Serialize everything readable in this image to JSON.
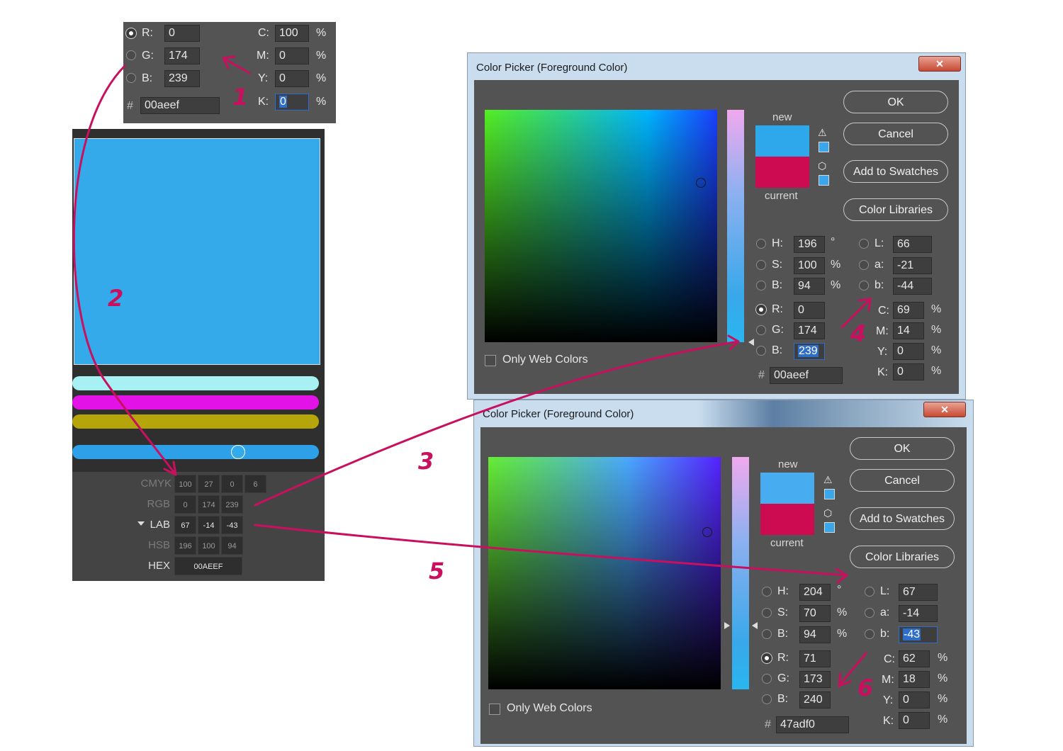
{
  "mini_panel": {
    "r_label": "R:",
    "r_value": "0",
    "g_label": "G:",
    "g_value": "174",
    "b_label": "B:",
    "b_value": "239",
    "c_label": "C:",
    "c_value": "100",
    "m_label": "M:",
    "m_value": "0",
    "y_label": "Y:",
    "y_value": "0",
    "k_label": "K:",
    "k_value": "0",
    "pct": "%",
    "hash": "#",
    "hex_value": "00aeef"
  },
  "theme_panel": {
    "main_color": "#35aaeb",
    "bars": [
      "#a7f0f4",
      "#e312e6",
      "#b5a50b",
      "#2ea0e8"
    ],
    "rows": [
      {
        "label": "CMYK",
        "values": [
          "100",
          "27",
          "0",
          "6"
        ]
      },
      {
        "label": "RGB",
        "values": [
          "0",
          "174",
          "239"
        ]
      },
      {
        "label": "LAB",
        "values": [
          "67",
          "-14",
          "-43"
        ]
      },
      {
        "label": "HSB",
        "values": [
          "196",
          "100",
          "94"
        ]
      }
    ],
    "hex_label": "HEX",
    "hex_value": "00AEEF"
  },
  "dialog1": {
    "title": "Color Picker (Foreground Color)",
    "close": "✕",
    "new_label": "new",
    "current_label": "current",
    "new_color": "#2ea8ea",
    "current_color": "#cc0b50",
    "ok": "OK",
    "cancel": "Cancel",
    "add_swatches": "Add to Swatches",
    "color_libraries": "Color Libraries",
    "only_web": "Only Web Colors",
    "h": "196",
    "s": "100",
    "b": "94",
    "r": "0",
    "g": "174",
    "bb": "239",
    "L": "66",
    "a": "-21",
    "lb": "-44",
    "c": "69",
    "m": "14",
    "y": "0",
    "k": "0",
    "hex": "00aeef"
  },
  "dialog2": {
    "title": "Color Picker (Foreground Color)",
    "close": "✕",
    "new_label": "new",
    "current_label": "current",
    "new_color": "#47adf0",
    "current_color": "#cc0b50",
    "ok": "OK",
    "cancel": "Cancel",
    "add_swatches": "Add to Swatches",
    "color_libraries": "Color Libraries",
    "only_web": "Only Web Colors",
    "h": "204",
    "s": "70",
    "b": "94",
    "r": "71",
    "g": "173",
    "bb": "240",
    "L": "67",
    "a": "-14",
    "lb": "-43",
    "c": "62",
    "m": "18",
    "y": "0",
    "k": "0",
    "hex": "47adf0"
  },
  "labels": {
    "H": "H:",
    "S": "S:",
    "B": "B:",
    "R": "R:",
    "G": "G:",
    "Bc": "B:",
    "L": "L:",
    "a": "a:",
    "b": "b:",
    "C": "C:",
    "M": "M:",
    "Y": "Y:",
    "K": "K:",
    "deg": "°",
    "pct": "%",
    "hash": "#"
  },
  "annotations": [
    "1",
    "2",
    "3",
    "4",
    "5",
    "6"
  ]
}
